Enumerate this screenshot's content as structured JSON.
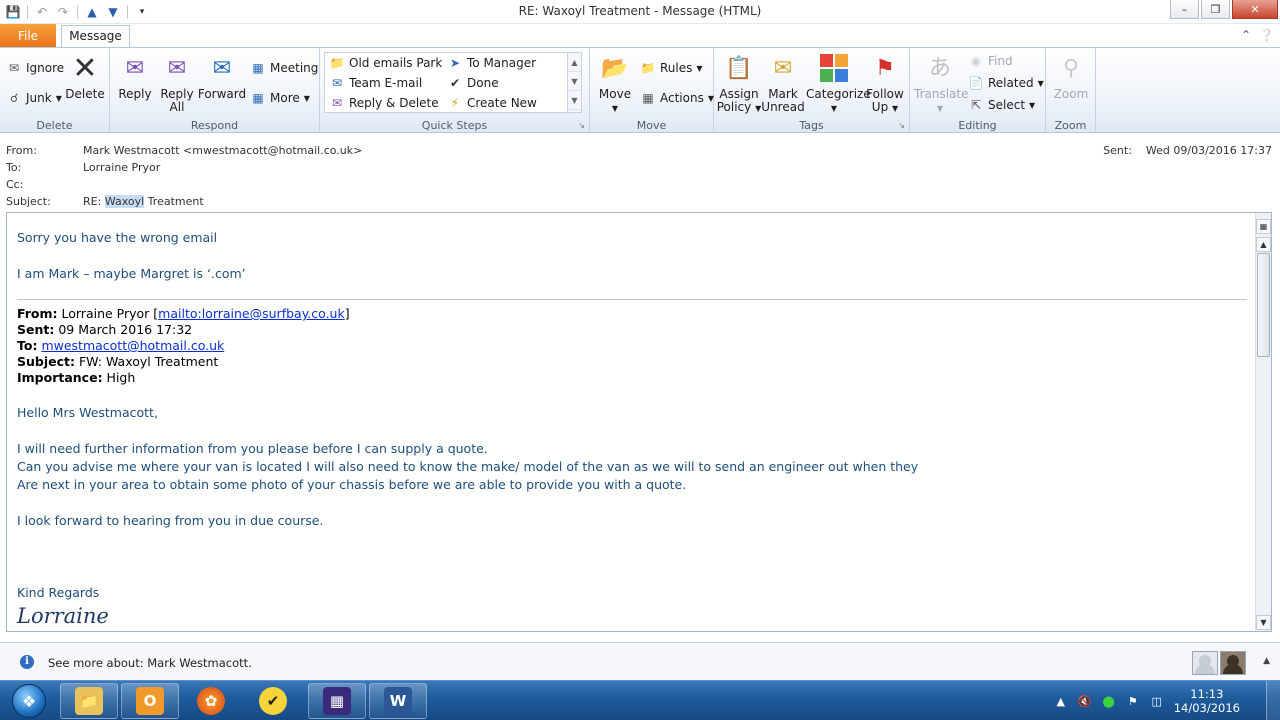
{
  "window": {
    "title": "RE: Waxoyl Treatment  -  Message (HTML)"
  },
  "tabs": {
    "file": "File",
    "message": "Message"
  },
  "ribbon": {
    "delete_group": {
      "label": "Delete",
      "ignore": "Ignore",
      "junk": "Junk",
      "delete": "Delete"
    },
    "respond_group": {
      "label": "Respond",
      "reply": "Reply",
      "reply_all_1": "Reply",
      "reply_all_2": "All",
      "forward": "Forward",
      "meeting": "Meeting",
      "more": "More"
    },
    "quick_steps": {
      "label": "Quick Steps",
      "items": [
        "Old emails Park",
        "Team E-mail",
        "Reply & Delete",
        "To Manager",
        "Done",
        "Create New"
      ]
    },
    "move_group": {
      "label": "Move",
      "move": "Move",
      "rules": "Rules",
      "actions": "Actions"
    },
    "tags_group": {
      "label": "Tags",
      "assign_1": "Assign",
      "assign_2": "Policy",
      "mark_1": "Mark",
      "mark_2": "Unread",
      "categorize": "Categorize",
      "follow_1": "Follow",
      "follow_2": "Up"
    },
    "editing_group": {
      "label": "Editing",
      "translate": "Translate",
      "find": "Find",
      "related": "Related",
      "select": "Select"
    },
    "zoom_group": {
      "label": "Zoom",
      "zoom": "Zoom"
    }
  },
  "header": {
    "from_label": "From:",
    "from_value": "Mark Westmacott <mwestmacott@hotmail.co.uk>",
    "to_label": "To:",
    "to_value": "Lorraine Pryor",
    "cc_label": "Cc:",
    "cc_value": "",
    "subject_label": "Subject:",
    "subject_prefix": "RE: ",
    "subject_highlight": "Waxoyl",
    "subject_rest": " Treatment",
    "sent_label": "Sent:",
    "sent_value": "Wed 09/03/2016 17:37"
  },
  "body": {
    "line1": "Sorry you have the wrong email",
    "line2": "I am Mark – maybe Margret is ‘.com’",
    "fwd_from_label": "From:",
    "fwd_from_name": " Lorraine Pryor [",
    "fwd_from_link": "mailto:lorraine@surfbay.co.uk",
    "fwd_from_close": "]",
    "fwd_sent_label": "Sent:",
    "fwd_sent_value": " 09 March 2016 17:32",
    "fwd_to_label": "To:",
    "fwd_to_link": "mwestmacott@hotmail.co.uk",
    "fwd_subject_label": "Subject:",
    "fwd_subject_value": " FW: Waxoyl Treatment",
    "fwd_importance_label": "Importance:",
    "fwd_importance_value": " High",
    "greeting": "Hello Mrs Westmacott,",
    "para1": "I will need further information from you please before I can supply a quote.",
    "para2": "Can you advise me where your van is located I will also need to know the  make/ model of the van as we will  to send an engineer out when they",
    "para3": "Are next in your area to obtain some photo of your chassis before we are able to provide you with a quote.",
    "para4": "I look forward to hearing from you in due course.",
    "regards": "Kind Regards",
    "signature": "Lorraine"
  },
  "people_pane": {
    "text": "See more about: Mark Westmacott."
  },
  "taskbar": {
    "time": "11:13",
    "date": "14/03/2016"
  },
  "colors": {
    "file_tab": "#e9741a",
    "body_text": "#1f4e79",
    "link": "#0b2fcf",
    "taskbar": "#1f5d9e"
  }
}
